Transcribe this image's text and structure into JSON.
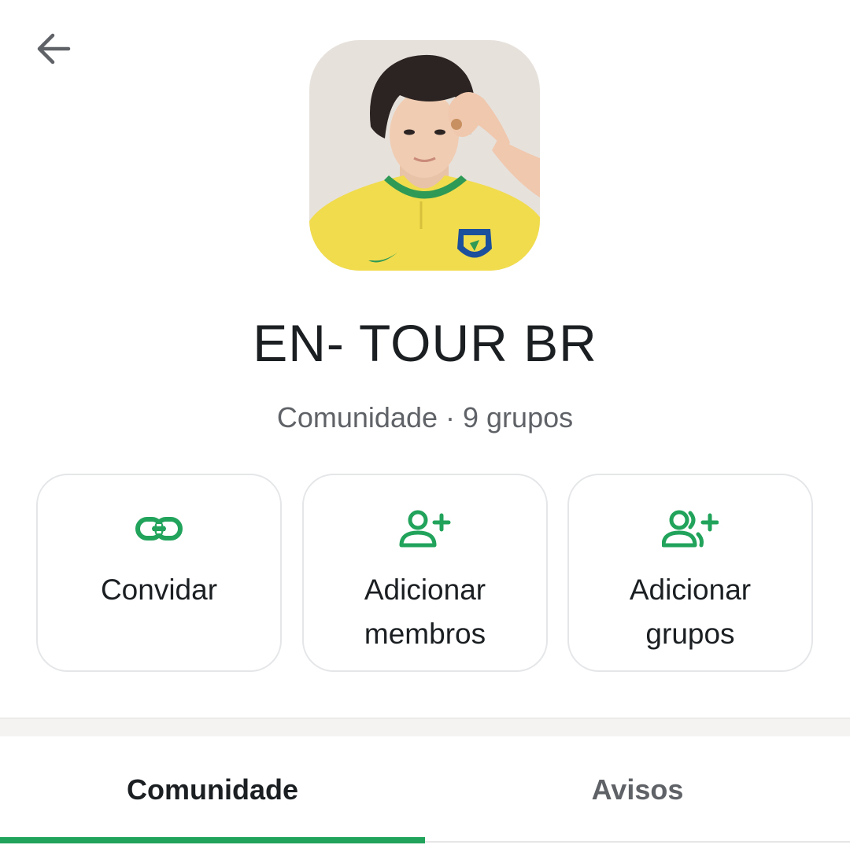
{
  "header": {
    "back_icon": "arrow-left-icon"
  },
  "community": {
    "name": "EN- TOUR BR",
    "type_label": "Comunidade",
    "separator": "·",
    "group_count": "9 grupos",
    "avatar": "community-photo"
  },
  "actions": [
    {
      "label_line1": "Convidar",
      "label_line2": "",
      "icon": "link-icon"
    },
    {
      "label_line1": "Adicionar",
      "label_line2": "membros",
      "icon": "add-person-icon"
    },
    {
      "label_line1": "Adicionar",
      "label_line2": "grupos",
      "icon": "add-group-icon"
    }
  ],
  "tabs": [
    {
      "label": "Comunidade",
      "selected": true
    },
    {
      "label": "Avisos",
      "selected": false
    }
  ],
  "colors": {
    "accent": "#21a35c",
    "text_primary": "#1b1f22",
    "text_secondary": "#5f6266"
  }
}
